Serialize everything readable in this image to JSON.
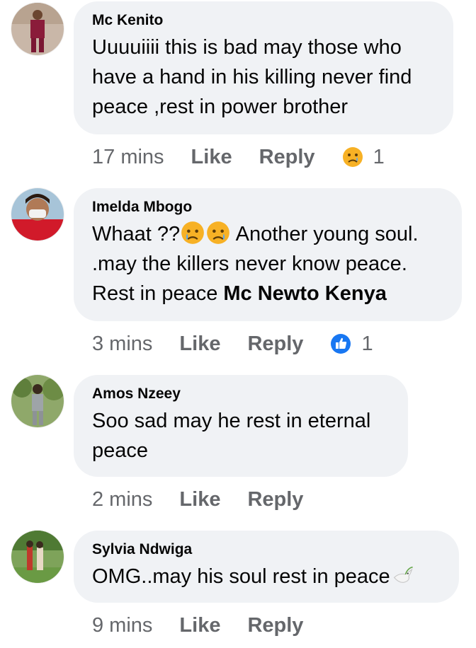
{
  "comments": [
    {
      "author": "Mc Kenito",
      "text": "Uuuuiiii this is bad may those who have a hand in his killing never find peace ,rest in power brother",
      "time": "17 mins",
      "like_label": "Like",
      "reply_label": "Reply",
      "reaction": "sad-face",
      "reaction_count": "1"
    },
    {
      "author": "Imelda Mbogo",
      "text_before": "Whaat ??",
      "text_after": " Another young soul. .may the killers never know peace. Rest in peace ",
      "mention": "Mc Newto Kenya",
      "time": "3 mins",
      "like_label": "Like",
      "reply_label": "Reply",
      "reaction": "thumbs-up",
      "reaction_count": "1"
    },
    {
      "author": "Amos Nzeey",
      "text": "Soo sad may he rest in eternal peace",
      "time": "2 mins",
      "like_label": "Like",
      "reply_label": "Reply"
    },
    {
      "author": "Sylvia Ndwiga",
      "text": "OMG..may his soul rest in peace",
      "time": "9 mins",
      "like_label": "Like",
      "reply_label": "Reply"
    }
  ],
  "colors": {
    "bubble": "#f0f2f5",
    "meta": "#65676b",
    "like_blue": "#1877f2"
  }
}
